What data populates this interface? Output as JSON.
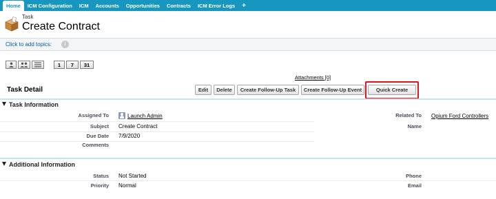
{
  "tabs": [
    {
      "label": "Home",
      "active": true
    },
    {
      "label": "ICM Configuration"
    },
    {
      "label": "ICM"
    },
    {
      "label": "Accounts"
    },
    {
      "label": "Opportunities"
    },
    {
      "label": "Contracts"
    },
    {
      "label": "ICM Error Logs"
    },
    {
      "label": "+"
    }
  ],
  "header": {
    "type_label": "Task",
    "title": "Create Contract",
    "icon": "task-box-icon"
  },
  "topics": {
    "link_text": "Click to add topics:",
    "info_icon": "i"
  },
  "view_buttons": {
    "single_user": "single-user-icon",
    "multi_user": "multi-user-icon",
    "list": "list-icon",
    "day": "1",
    "week": "7",
    "month": "31"
  },
  "attachments_link": "Attachments [0]",
  "detail": {
    "title": "Task Detail",
    "buttons": {
      "edit": "Edit",
      "delete": "Delete",
      "follow_up_task": "Create Follow-Up Task",
      "follow_up_event": "Create Follow-Up Event",
      "quick_create": "Quick Create"
    }
  },
  "task_info": {
    "header": "Task Information",
    "assigned_to_label": "Assigned To",
    "assigned_to_value": "Launch Admin",
    "subject_label": "Subject",
    "subject_value": "Create Contract",
    "due_date_label": "Due Date",
    "due_date_value": "7/9/2020",
    "comments_label": "Comments",
    "comments_value": "",
    "related_to_label": "Related To",
    "related_to_value": "Opium Ford Controllers",
    "name_label": "Name",
    "name_value": ""
  },
  "additional_info": {
    "header": "Additional Information",
    "status_label": "Status",
    "status_value": "Not Started",
    "priority_label": "Priority",
    "priority_value": "Normal",
    "phone_label": "Phone",
    "phone_value": "",
    "email_label": "Email",
    "email_value": ""
  },
  "colors": {
    "tab_bar": "#1797c0",
    "link": "#015ba7",
    "highlight": "#e0141d"
  }
}
